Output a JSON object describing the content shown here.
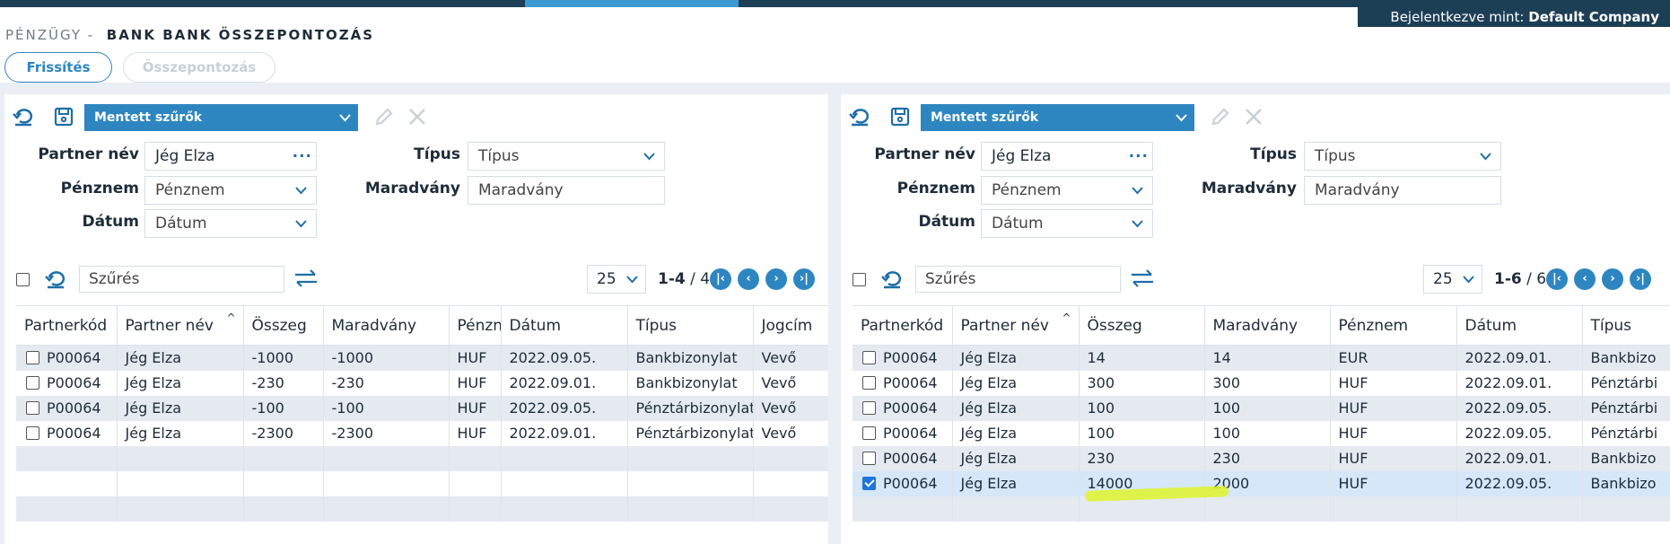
{
  "header": {
    "module": "PÉNZÜGY -",
    "page_title": "BANK BANK ÖSSZEPONTOZÁS",
    "login_prefix": "Bejelentkezve mint:",
    "login_company": "Default Company",
    "refresh_button": "Frissítés",
    "reconcile_button": "Összepontozás"
  },
  "left": {
    "saved_filters": "Mentett szűrők",
    "filters": {
      "partner_label": "Partner név",
      "partner_value": "Jég Elza",
      "currency_label": "Pénznem",
      "currency_value": "Pénznem",
      "date_label": "Dátum",
      "date_value": "Dátum",
      "type_label": "Típus",
      "type_value": "Típus",
      "remainder_label": "Maradvány",
      "remainder_value": "Maradvány"
    },
    "search_placeholder": "Szűrés",
    "page_size": "25",
    "range": "1-4",
    "total": "/ 4",
    "columns": [
      "Partnerkód",
      "Partner név",
      "Összeg",
      "Maradvány",
      "Pénznem",
      "Dátum",
      "Típus",
      "Jogcím"
    ],
    "rows": [
      {
        "code": "P00064",
        "name": "Jég Elza",
        "amount": "-1000",
        "rem": "-1000",
        "cur": "HUF",
        "date": "2022.09.05.",
        "type": "Bankbizonylat",
        "title": "Vevő"
      },
      {
        "code": "P00064",
        "name": "Jég Elza",
        "amount": "-230",
        "rem": "-230",
        "cur": "HUF",
        "date": "2022.09.01.",
        "type": "Bankbizonylat",
        "title": "Vevő"
      },
      {
        "code": "P00064",
        "name": "Jég Elza",
        "amount": "-100",
        "rem": "-100",
        "cur": "HUF",
        "date": "2022.09.05.",
        "type": "Pénztárbizonylat",
        "title": "Vevő"
      },
      {
        "code": "P00064",
        "name": "Jég Elza",
        "amount": "-2300",
        "rem": "-2300",
        "cur": "HUF",
        "date": "2022.09.01.",
        "type": "Pénztárbizonylat",
        "title": "Vevő"
      }
    ]
  },
  "right": {
    "saved_filters": "Mentett szűrők",
    "filters": {
      "partner_label": "Partner név",
      "partner_value": "Jég Elza",
      "currency_label": "Pénznem",
      "currency_value": "Pénznem",
      "date_label": "Dátum",
      "date_value": "Dátum",
      "type_label": "Típus",
      "type_value": "Típus",
      "remainder_label": "Maradvány",
      "remainder_value": "Maradvány"
    },
    "search_placeholder": "Szűrés",
    "page_size": "25",
    "range": "1-6",
    "total": "/ 6",
    "columns": [
      "Partnerkód",
      "Partner név",
      "Összeg",
      "Maradvány",
      "Pénznem",
      "Dátum",
      "Típus"
    ],
    "rows": [
      {
        "code": "P00064",
        "name": "Jég Elza",
        "amount": "14",
        "rem": "14",
        "cur": "EUR",
        "date": "2022.09.01.",
        "type": "Bankbizo",
        "checked": false
      },
      {
        "code": "P00064",
        "name": "Jég Elza",
        "amount": "300",
        "rem": "300",
        "cur": "HUF",
        "date": "2022.09.01.",
        "type": "Pénztárbi",
        "checked": false
      },
      {
        "code": "P00064",
        "name": "Jég Elza",
        "amount": "100",
        "rem": "100",
        "cur": "HUF",
        "date": "2022.09.05.",
        "type": "Pénztárbi",
        "checked": false
      },
      {
        "code": "P00064",
        "name": "Jég Elza",
        "amount": "100",
        "rem": "100",
        "cur": "HUF",
        "date": "2022.09.05.",
        "type": "Pénztárbi",
        "checked": false
      },
      {
        "code": "P00064",
        "name": "Jég Elza",
        "amount": "230",
        "rem": "230",
        "cur": "HUF",
        "date": "2022.09.01.",
        "type": "Bankbizo",
        "checked": false
      },
      {
        "code": "P00064",
        "name": "Jég Elza",
        "amount": "14000",
        "rem": "2000",
        "cur": "HUF",
        "date": "2022.09.05.",
        "type": "Bankbizo",
        "checked": true
      }
    ]
  },
  "colors": {
    "accent": "#2e86c1",
    "topbar": "#1d3f56",
    "highlight": "#dff42a"
  }
}
